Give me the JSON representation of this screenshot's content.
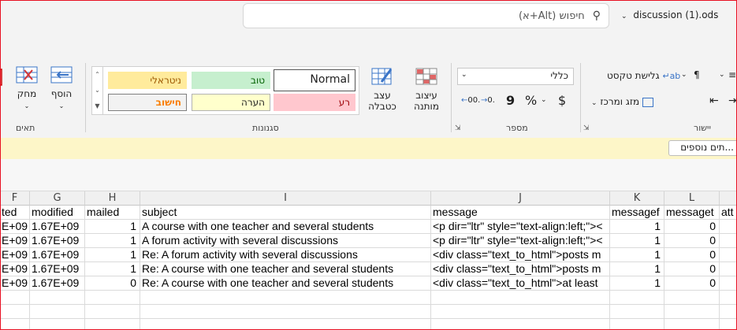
{
  "titlebar": {
    "search_placeholder": "חיפוש (Alt+א)",
    "doc_title": "discussion (1).ods"
  },
  "ribbon": {
    "cells": {
      "insert": "הוסף",
      "delete": "מחק",
      "label": "תאים"
    },
    "styles": {
      "format_as_table": "עצב כטבלה",
      "conditional_format": "עיצוב מותנה",
      "label": "סגנונות",
      "items": {
        "normal": "Normal",
        "good": "טוב",
        "neutral": "ניטראלי",
        "bad": "רע",
        "note": "הערה",
        "important": "חישוב"
      },
      "colors": {
        "good_bg": "#c6efce",
        "neutral_bg": "#ffeb9c",
        "bad_bg": "#ffc7ce",
        "note_bg": "#ffffcc",
        "important_fg": "#fa7d00"
      }
    },
    "number": {
      "format_value": "כללי",
      "label": "מספר",
      "currency": "$",
      "percent": "%",
      "comma": "9",
      "inc_decimal": ".00",
      "dec_decimal": ".0"
    },
    "alignment": {
      "wrap_text": "גלישת טקסט",
      "merge_center": "מזג ומרכז",
      "label": "יישור"
    }
  },
  "infobar": {
    "button": "...תים נוספים"
  },
  "grid": {
    "columns": [
      "F",
      "G",
      "H",
      "I",
      "J",
      "K",
      "L",
      ""
    ],
    "header_row": [
      "ted",
      "modified",
      "mailed",
      "subject",
      "message",
      "messagef",
      "messaget",
      "att"
    ],
    "rows": [
      [
        "E+09",
        "1.67E+09",
        "1",
        "A course with one teacher and several students",
        "<p dir=\"ltr\" style=\"text-align:left;\"><",
        "1",
        "0",
        ""
      ],
      [
        "E+09",
        "1.67E+09",
        "1",
        "A forum activity with several discussions",
        "<p dir=\"ltr\" style=\"text-align:left;\"><",
        "1",
        "0",
        ""
      ],
      [
        "E+09",
        "1.67E+09",
        "1",
        "Re: A forum activity with several discussions",
        "<div class=\"text_to_html\">posts m",
        "1",
        "0",
        ""
      ],
      [
        "E+09",
        "1.67E+09",
        "1",
        "Re: A course with one teacher and several students",
        "<div class=\"text_to_html\">posts m",
        "1",
        "0",
        ""
      ],
      [
        "E+09",
        "1.67E+09",
        "0",
        "Re: A course with one teacher and several students",
        "<div class=\"text_to_html\">at least",
        "1",
        "0",
        ""
      ]
    ]
  }
}
